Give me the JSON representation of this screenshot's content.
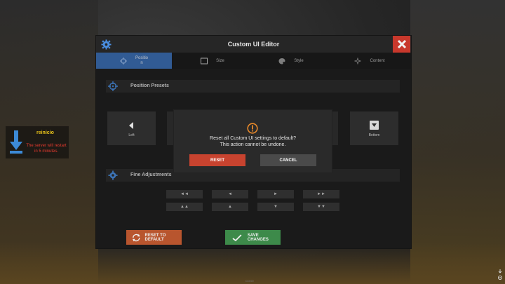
{
  "notification": {
    "title": "reinicio",
    "message": "The server will restart in 5 minutes.",
    "title_color": "#e8c21a",
    "message_color": "#e63a2e",
    "icon": "download-arrow-icon"
  },
  "editor": {
    "title": "Custom UI Editor",
    "header_icon": "gear-icon",
    "close_icon": "close-icon",
    "accent": "#3c6fb5",
    "close_color": "#c8382c"
  },
  "tabs": [
    {
      "label": "Positio n",
      "icon": "crosshair-icon",
      "active": true
    },
    {
      "label": "Size",
      "icon": "square-icon",
      "active": false
    },
    {
      "label": "Style",
      "icon": "palette-icon",
      "active": false
    },
    {
      "label": "Content",
      "icon": "sparkle-icon",
      "active": false
    }
  ],
  "sections": {
    "presets": {
      "label": "Position Presets",
      "icon": "crosshair-icon"
    },
    "fine": {
      "label": "Fine Adjustments",
      "icon": "gear-icon"
    }
  },
  "presets": [
    {
      "label": "Left",
      "icon": "arrow-left-icon"
    },
    {
      "label": "Bottom",
      "icon": "arrow-down-icon"
    }
  ],
  "fine_buttons": {
    "row1": [
      "◄◄",
      "◄",
      "►",
      "►►"
    ],
    "row2": [
      "▲▲",
      "▲",
      "▼",
      "▼▼"
    ]
  },
  "footer": {
    "reset_label": "RESET TO DEFAULT",
    "save_label": "SAVE CHANGES",
    "reset_color": "#b8552e",
    "save_color": "#3d8a4a"
  },
  "dialog": {
    "line1": "Reset all Custom UI settings to default?",
    "line2": "This action cannot be undone.",
    "reset_label": "RESET",
    "cancel_label": "CANCEL",
    "warn_icon": "warning-icon",
    "warn_color": "#e8892a",
    "reset_color": "#c8432f",
    "cancel_color": "#4a4a4a"
  },
  "status_text": "CO:00"
}
